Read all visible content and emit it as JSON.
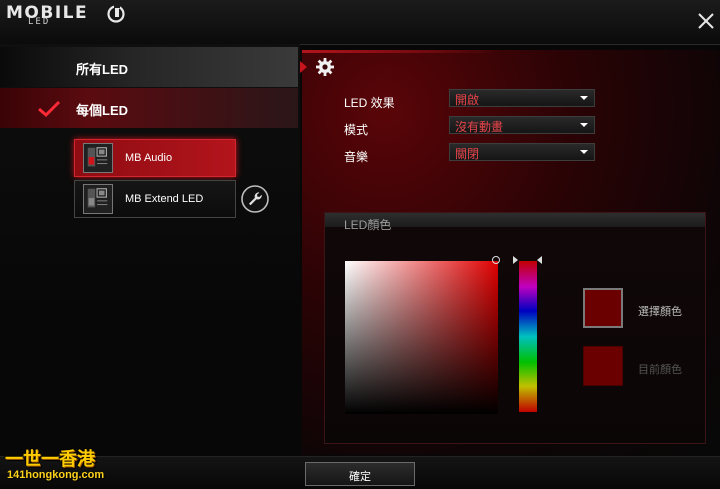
{
  "app": {
    "logo_main": "MOBILE",
    "logo_sub": "LED"
  },
  "nav": {
    "all_led": "所有LED",
    "each_led": "每個LED"
  },
  "devices": [
    {
      "label": "MB Audio",
      "selected": true
    },
    {
      "label": "MB Extend LED",
      "selected": false
    }
  ],
  "settings": {
    "led_effect_label": "LED 效果",
    "led_effect_value": "開啟",
    "mode_label": "模式",
    "mode_value": "沒有動畫",
    "music_label": "音樂",
    "music_value": "關閉"
  },
  "color": {
    "group_title": "LED顏色",
    "select_label": "選擇顏色",
    "current_label": "目前顏色",
    "selected_hex": "#6a0000",
    "current_hex": "#6a0000"
  },
  "footer": {
    "ok_label": "確定"
  },
  "watermark": {
    "line1": "一世一香港",
    "line2": "141hongkong.com"
  },
  "colors": {
    "accent": "#c8141c",
    "value_text": "#e8434a"
  }
}
